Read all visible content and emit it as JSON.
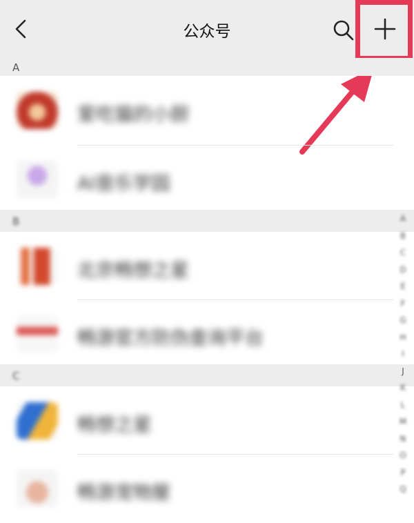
{
  "header": {
    "title": "公众号",
    "back_icon": "back-chevron-icon",
    "search_icon": "search-icon",
    "add_icon": "plus-icon"
  },
  "annotation": {
    "box_color": "#e43a58",
    "arrow_color": "#e43a58"
  },
  "sections": [
    {
      "letter": "A",
      "items": [
        {
          "name": "爱吃猫的小厨",
          "avatar_color": "#c0392b"
        },
        {
          "name": "AI音乐学园",
          "avatar_color": "#c9a7e8"
        }
      ]
    },
    {
      "letter": "B",
      "items": [
        {
          "name": "北京畅想之星",
          "avatar_color": "#e46a3a"
        },
        {
          "name": "畅游官方防伪查询平台",
          "avatar_color": "#d9534f"
        }
      ]
    },
    {
      "letter": "C",
      "items": [
        {
          "name": "畅想之星",
          "avatar_color": "#2f6fd0"
        },
        {
          "name": "畅游宠物屋",
          "avatar_color": "#e8b4a0"
        }
      ]
    }
  ],
  "index_letters": [
    "A",
    "B",
    "C",
    "D",
    "E",
    "F",
    "G",
    "H",
    "I",
    "J",
    "K",
    "L",
    "M",
    "N",
    "O",
    "P",
    "Q"
  ]
}
